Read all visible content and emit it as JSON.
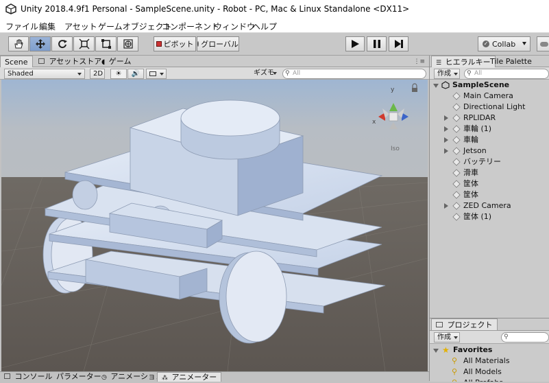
{
  "window": {
    "title": "Unity 2018.4.9f1 Personal - SampleScene.unity - Robot - PC, Mac & Linux Standalone <DX11>"
  },
  "menu": [
    "ファイル",
    "編集",
    "アセット",
    "ゲームオブジェクト",
    "コンポーネント",
    "ウィンドウ",
    "ヘルプ"
  ],
  "toolbar": {
    "tools": [
      "hand-tool-icon",
      "move-tool-icon",
      "rotate-tool-icon",
      "scale-tool-icon",
      "rect-tool-icon",
      "transform-tool-icon"
    ],
    "pivot_label": "ピボット",
    "global_label": "グローバル",
    "collab_label": "Collab"
  },
  "scene_tabs": {
    "scene": "Scene",
    "asset_store": "アセットストア",
    "game": "ゲーム"
  },
  "scene_toolbar": {
    "shading": "Shaded",
    "mode_2d": "2D",
    "gizmos": "ギズモ",
    "search_placeholder": "All"
  },
  "gizmo": {
    "y": "y",
    "x": "x",
    "projection": "Iso"
  },
  "hierarchy": {
    "tab": "ヒエラルキー",
    "tab2": "Tile Palette",
    "create": "作成",
    "search_placeholder": "All",
    "scene": "SampleScene",
    "items": [
      {
        "label": "Main Camera",
        "expandable": false
      },
      {
        "label": "Directional Light",
        "expandable": false
      },
      {
        "label": "RPLIDAR",
        "expandable": true
      },
      {
        "label": "車輪 (1)",
        "expandable": true
      },
      {
        "label": "車輪",
        "expandable": true
      },
      {
        "label": "Jetson",
        "expandable": true
      },
      {
        "label": "バッテリー",
        "expandable": false
      },
      {
        "label": "滑車",
        "expandable": false
      },
      {
        "label": "筐体",
        "expandable": false
      },
      {
        "label": "筐体",
        "expandable": false
      },
      {
        "label": "ZED Camera",
        "expandable": true
      },
      {
        "label": "筐体 (1)",
        "expandable": false
      }
    ]
  },
  "project": {
    "tab": "プロジェクト",
    "create": "作成",
    "favorites": "Favorites",
    "items": [
      "All Materials",
      "All Models",
      "All Prefabs"
    ]
  },
  "bottom_tabs": [
    "コンソール",
    "パラメーター",
    "アニメーション",
    "アニメーター"
  ]
}
